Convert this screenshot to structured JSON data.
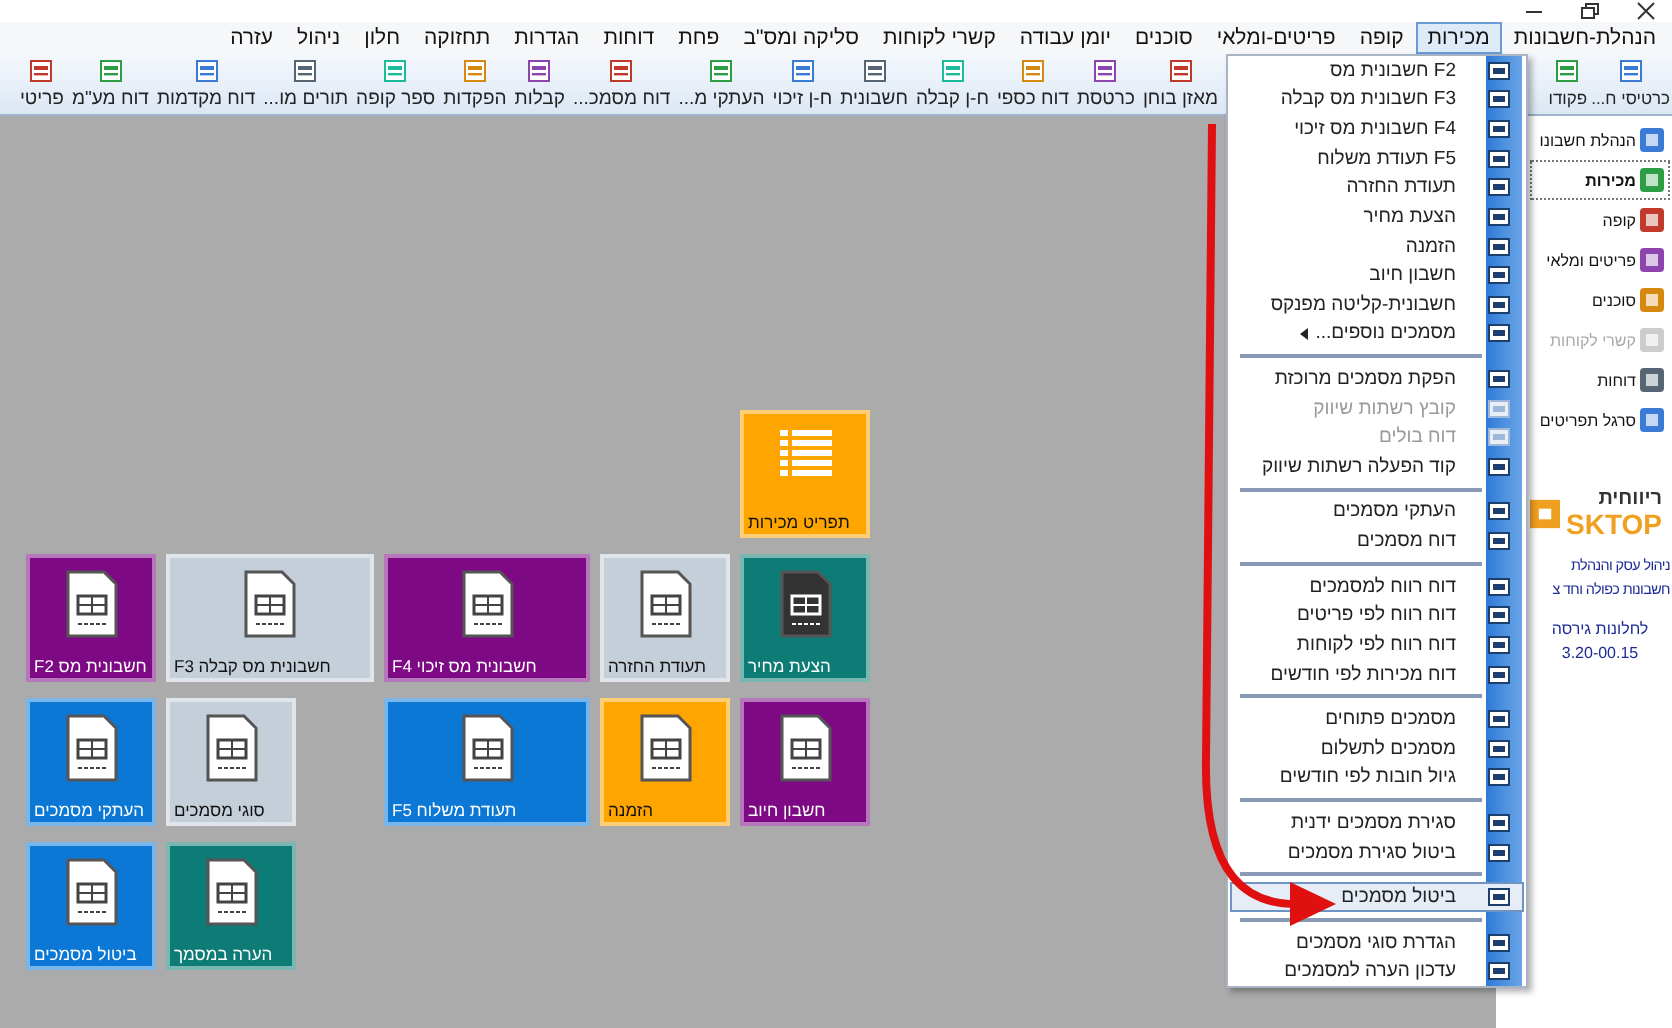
{
  "menu_bar": [
    {
      "label": "הנהלת-חשבונות",
      "selected": false
    },
    {
      "label": "מכירות",
      "selected": true
    },
    {
      "label": "קופה",
      "selected": false
    },
    {
      "label": "פריטים-ומלאי",
      "selected": false
    },
    {
      "label": "סוכנים",
      "selected": false
    },
    {
      "label": "יומן עבודה",
      "selected": false
    },
    {
      "label": "קשרי לקוחות",
      "selected": false
    },
    {
      "label": "סליקה ומס\"ב",
      "selected": false
    },
    {
      "label": "פחת",
      "selected": false
    },
    {
      "label": "דוחות",
      "selected": false
    },
    {
      "label": "הגדרות",
      "selected": false
    },
    {
      "label": "תחזוקה",
      "selected": false
    },
    {
      "label": "חלון",
      "selected": false
    },
    {
      "label": "ניהול",
      "selected": false
    },
    {
      "label": "עזרה",
      "selected": false
    }
  ],
  "toolbar_right": [
    "כרטיסי ח...",
    "פקודו"
  ],
  "toolbar_left": [
    "מאזן בוחן",
    "כרטסת",
    "דוח כספי",
    "ח-ן קבלה",
    "חשבונית",
    "ח-ן זיכוי",
    "העתקי מ...",
    "דוח מסמכ...",
    "קבלות",
    "הפקדות",
    "ספר קופה",
    "תורים מו...",
    "דוח מקדמות",
    "דוח מע\"מ",
    "פריטי"
  ],
  "tiles": [
    {
      "label": "תפריט מכירות",
      "color": "#ffa500"
    },
    {
      "label": "הצעת מחיר",
      "color": "#0e7c76"
    },
    {
      "label": "תעודת החזרה",
      "color": "#c5cfd9"
    },
    {
      "label": "חשבונית מס זיכוי F4",
      "color": "#7d0a84"
    },
    {
      "label": "חשבונית מס קבלה F3",
      "color": "#c5cfd9"
    },
    {
      "label": "חשבונית מס F2",
      "color": "#7d0a84"
    },
    {
      "label": "חשבון חיוב",
      "color": "#7d0a84"
    },
    {
      "label": "הזמנה",
      "color": "#ffa500"
    },
    {
      "label": "תעודת משלוח F5",
      "color": "#0b78d6"
    },
    {
      "label": "סוגי מסמכים",
      "color": "#c5cfd9"
    },
    {
      "label": "העתקי מסמכים",
      "color": "#0b78d6"
    },
    {
      "label": "הערה במסמך",
      "color": "#0e7c76"
    },
    {
      "label": "ביטול מסמכים",
      "color": "#0b78d6"
    }
  ],
  "dropdown": {
    "groups": [
      [
        {
          "label": "F2 חשבונית מס",
          "kind": "item",
          "disabled": false,
          "selected": false
        },
        {
          "label": "F3 חשבונית מס קבלה",
          "kind": "item",
          "disabled": false,
          "selected": false
        },
        {
          "label": "F4 חשבונית מס זיכוי",
          "kind": "item",
          "disabled": false,
          "selected": false
        },
        {
          "label": "F5 תעודת משלוח",
          "kind": "item",
          "disabled": false,
          "selected": false
        },
        {
          "label": "תעודת החזרה",
          "kind": "item",
          "disabled": false,
          "selected": false
        },
        {
          "label": "הצעת מחיר",
          "kind": "item",
          "disabled": false,
          "selected": false
        },
        {
          "label": "הזמנה",
          "kind": "item",
          "disabled": false,
          "selected": false
        },
        {
          "label": "חשבון חיוב",
          "kind": "item",
          "disabled": false,
          "selected": false
        },
        {
          "label": "חשבונית-קליטה מפנקס",
          "kind": "item",
          "disabled": false,
          "selected": false
        },
        {
          "label": "מסמכים נוספים...",
          "kind": "submenu",
          "disabled": false,
          "selected": false
        }
      ],
      [
        {
          "label": "הפקת מסמכים מרוכזת",
          "kind": "item",
          "disabled": false,
          "selected": false
        },
        {
          "label": "קובץ רשתות שיווק",
          "kind": "item",
          "disabled": true,
          "selected": false
        },
        {
          "label": "דוח בולים",
          "kind": "item",
          "disabled": true,
          "selected": false
        },
        {
          "label": "קוד הפעלה רשתות שיווק",
          "kind": "item",
          "disabled": false,
          "selected": false
        }
      ],
      [
        {
          "label": "העתקי מסמכים",
          "kind": "item",
          "disabled": false,
          "selected": false
        },
        {
          "label": "דוח מסמכים",
          "kind": "item",
          "disabled": false,
          "selected": false
        }
      ],
      [
        {
          "label": "דוח רווח למסמכים",
          "kind": "item",
          "disabled": false,
          "selected": false
        },
        {
          "label": "דוח רווח לפי פריטים",
          "kind": "item",
          "disabled": false,
          "selected": false
        },
        {
          "label": "דוח רווח לפי לקוחות",
          "kind": "item",
          "disabled": false,
          "selected": false
        },
        {
          "label": "דוח מכירות לפי חודשים",
          "kind": "item",
          "disabled": false,
          "selected": false
        }
      ],
      [
        {
          "label": "מסמכים פתוחים",
          "kind": "item",
          "disabled": false,
          "selected": false
        },
        {
          "label": "מסמכים לתשלום",
          "kind": "item",
          "disabled": false,
          "selected": false
        },
        {
          "label": "גיול חובות לפי חודשים",
          "kind": "item",
          "disabled": false,
          "selected": false
        }
      ],
      [
        {
          "label": "סגירת מסמכים ידנית",
          "kind": "item",
          "disabled": false,
          "selected": false
        },
        {
          "label": "ביטול סגירת מסמכים",
          "kind": "item",
          "disabled": false,
          "selected": false
        }
      ],
      [
        {
          "label": "ביטול מסמכים",
          "kind": "item",
          "disabled": false,
          "selected": true
        }
      ],
      [
        {
          "label": "הגדרת סוגי מסמכים",
          "kind": "item",
          "disabled": false,
          "selected": false
        },
        {
          "label": "עדכון הערה למסמכים",
          "kind": "item",
          "disabled": false,
          "selected": false
        }
      ]
    ]
  },
  "sidebar": {
    "items": [
      {
        "label": "הנהלת חשבונו",
        "selected": false,
        "disabled": false
      },
      {
        "label": "מכירות",
        "selected": true,
        "disabled": false
      },
      {
        "label": "קופה",
        "selected": false,
        "disabled": false
      },
      {
        "label": "פריטים ומלאי",
        "selected": false,
        "disabled": false
      },
      {
        "label": "סוכנים",
        "selected": false,
        "disabled": false
      },
      {
        "label": "קשרי לקוחות",
        "selected": false,
        "disabled": true
      },
      {
        "label": "דוחות",
        "selected": false,
        "disabled": false
      },
      {
        "label": "סרגל תפריטים",
        "selected": false,
        "disabled": false
      }
    ],
    "logo": {
      "name": "ריווחית",
      "word": "SKTOP"
    },
    "description": [
      "ניהול עסק והנהלת",
      "חשבונות כפולה וחד צ"
    ],
    "version": [
      "לחלונות גירסה",
      "3.20-00.15"
    ]
  }
}
